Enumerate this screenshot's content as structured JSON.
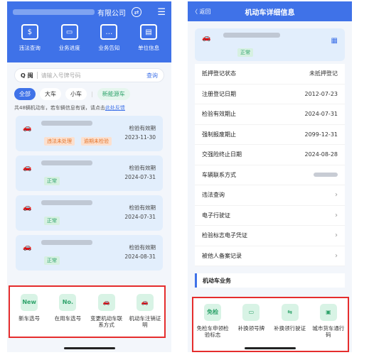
{
  "left": {
    "header": {
      "company_suffix": "有限公司",
      "swap_icon": "⇄",
      "menu_icon": "☰"
    },
    "quick_actions": [
      {
        "label": "违法查询",
        "icon": "$"
      },
      {
        "label": "业务进度",
        "icon": "▭"
      },
      {
        "label": "业务告知",
        "icon": "…"
      },
      {
        "label": "单位信息",
        "icon": "▤"
      }
    ],
    "search": {
      "prefix": "Q 闽",
      "placeholder": "请输入号牌号码",
      "button": "查询"
    },
    "filters": [
      "全部",
      "大车",
      "小车",
      "新能源车"
    ],
    "tip": {
      "text": "共48辆机动车，若车辆信息有误，请点击",
      "link": "此处反馈"
    },
    "vehicles": [
      {
        "tags": [
          "违法未处理",
          "逾期未检验"
        ],
        "label": "检验有效期",
        "date": "2023-11-30"
      },
      {
        "tags": [
          "正常"
        ],
        "label": "检验有效期",
        "date": "2024-07-31"
      },
      {
        "tags": [
          "正常"
        ],
        "label": "检验有效期",
        "date": "2024-07-31"
      },
      {
        "tags": [
          "正常"
        ],
        "label": "检验有效期",
        "date": "2024-08-31"
      }
    ],
    "business": [
      {
        "label": "新车选号",
        "icon": "New"
      },
      {
        "label": "在用车选号",
        "icon": "No."
      },
      {
        "label": "变更机动车联系方式",
        "icon": "🚗"
      },
      {
        "label": "机动车注销证明",
        "icon": "🚗"
      }
    ]
  },
  "right": {
    "header": {
      "back": "〈 返回",
      "title": "机动车详细信息"
    },
    "card": {
      "status": "正常",
      "qr_icon": "▦"
    },
    "rows": [
      {
        "label": "抵押登记状态",
        "value": "未抵押登记"
      },
      {
        "label": "注册登记日期",
        "value": "2012-07-23"
      },
      {
        "label": "检验有效期止",
        "value": "2024-07-31"
      },
      {
        "label": "强制报废期止",
        "value": "2099-12-31"
      },
      {
        "label": "交强险终止日期",
        "value": "2024-08-28"
      },
      {
        "label": "车辆联系方式",
        "value": ""
      },
      {
        "label": "违法查询",
        "value": "›"
      },
      {
        "label": "电子行驶证",
        "value": "›"
      },
      {
        "label": "检验标志电子凭证",
        "value": "›"
      },
      {
        "label": "被他人备案记录",
        "value": "›"
      }
    ],
    "section_title": "机动车业务",
    "business": [
      {
        "label": "免检车申领检验标志",
        "icon": "免检"
      },
      {
        "label": "补换领号牌",
        "icon": "▭"
      },
      {
        "label": "补换领行驶证",
        "icon": "⇆"
      },
      {
        "label": "城市货车通行码",
        "icon": "▣"
      }
    ]
  },
  "colors": {
    "primary": "#3f72e8",
    "card": "#e2eefc",
    "green": "#2fa36b",
    "orange": "#e5742a",
    "highlight": "#e52d2d"
  }
}
